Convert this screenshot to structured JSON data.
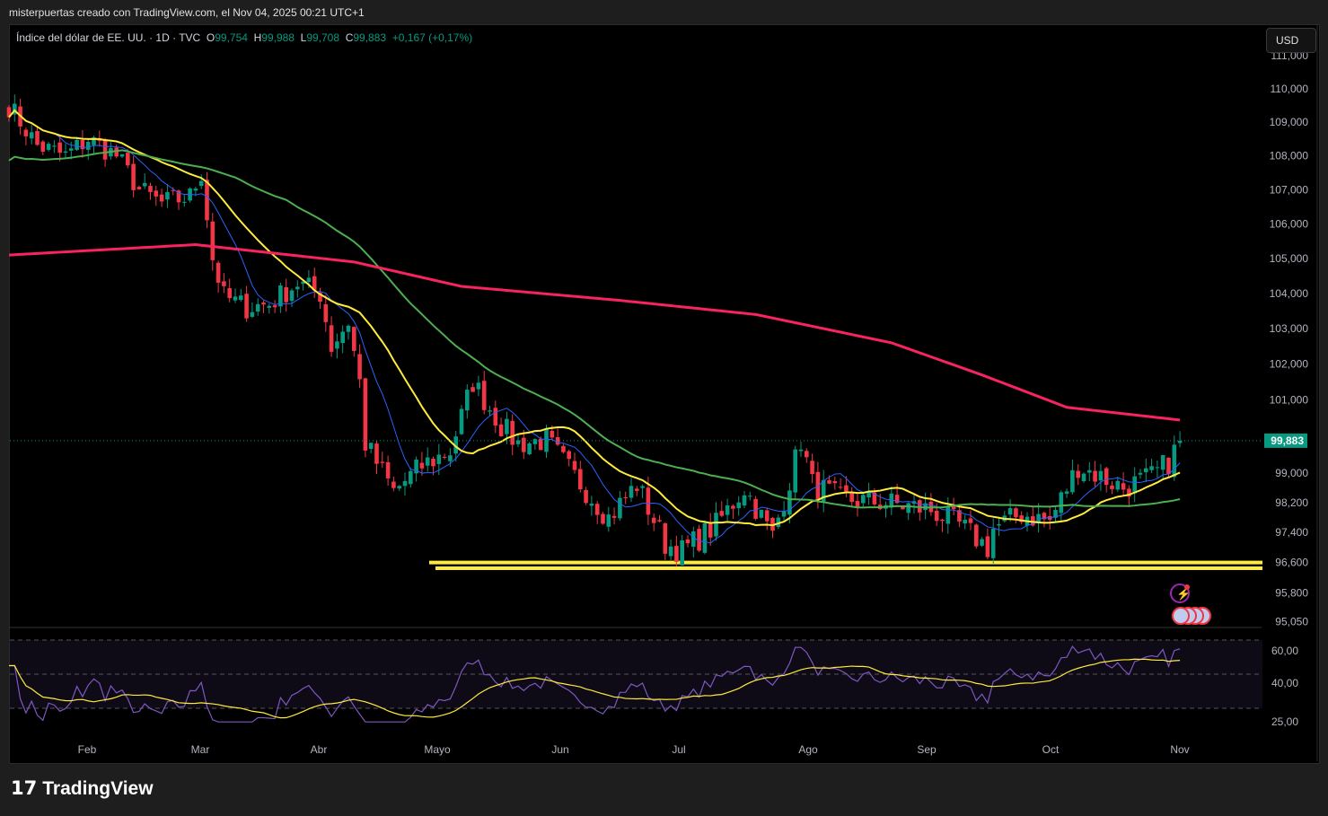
{
  "header": {
    "credit": "misterpuertas creado con TradingView.com, el Nov 04, 2025 00:21 UTC+1"
  },
  "legend": {
    "symbol": "Índice del dólar de EE. UU. · 1D · TVC",
    "o_label": "O",
    "open": "99,754",
    "h_label": "H",
    "high": "99,988",
    "l_label": "L",
    "low": "99,708",
    "c_label": "C",
    "close": "99,883",
    "change": "+0,167 (+0,17%)"
  },
  "currency_button": "USD",
  "price_axis": [
    "111,000",
    "110,000",
    "109,000",
    "108,000",
    "107,000",
    "106,000",
    "105,000",
    "104,000",
    "103,000",
    "102,000",
    "101,000",
    "99,000",
    "98,200",
    "97,400",
    "96,600",
    "95,800",
    "95,050"
  ],
  "last_price": "99,883",
  "rsi_axis": [
    "60,00",
    "40,00",
    "25,00"
  ],
  "time_axis": [
    "Feb",
    "Mar",
    "Abr",
    "Mayo",
    "Jun",
    "Jul",
    "Ago",
    "Sep",
    "Oct",
    "Nov"
  ],
  "colors": {
    "up": "#089981",
    "down": "#f23645",
    "ma_fast": "#2962ff",
    "ma_mid": "#ffeb3b",
    "ma_slow": "#4caf50",
    "ma_long": "#f7245f",
    "rsi": "#7e57c2"
  },
  "chart_data": {
    "type": "candlestick",
    "price_path": [
      [
        0,
        109.5
      ],
      [
        5,
        108.3
      ],
      [
        10,
        108.0
      ],
      [
        14,
        108.5
      ],
      [
        19,
        108.0
      ],
      [
        23,
        107.0
      ],
      [
        27,
        106.6
      ],
      [
        32,
        106.8
      ],
      [
        34,
        107.5
      ],
      [
        36,
        105.0
      ],
      [
        38,
        103.9
      ],
      [
        42,
        103.6
      ],
      [
        46,
        103.7
      ],
      [
        51,
        104.3
      ],
      [
        55,
        104.0
      ],
      [
        57,
        102.5
      ],
      [
        60,
        103.2
      ],
      [
        62,
        101.5
      ],
      [
        63,
        99.8
      ],
      [
        68,
        98.5
      ],
      [
        73,
        99.2
      ],
      [
        78,
        99.6
      ],
      [
        82,
        101.5
      ],
      [
        87,
        100.3
      ],
      [
        90,
        99.8
      ],
      [
        95,
        99.9
      ],
      [
        100,
        98.9
      ],
      [
        106,
        97.8
      ],
      [
        111,
        98.7
      ],
      [
        116,
        97.1
      ],
      [
        119,
        96.9
      ],
      [
        125,
        97.6
      ],
      [
        130,
        98.6
      ],
      [
        135,
        97.3
      ],
      [
        138,
        98.8
      ],
      [
        140,
        99.9
      ],
      [
        142,
        98.7
      ],
      [
        147,
        98.3
      ],
      [
        155,
        98.2
      ],
      [
        163,
        98.0
      ],
      [
        168,
        97.6
      ],
      [
        173,
        97.0
      ],
      [
        174,
        97.5
      ],
      [
        179,
        97.9
      ],
      [
        184,
        97.7
      ],
      [
        189,
        99.2
      ],
      [
        193,
        98.9
      ],
      [
        197,
        98.6
      ],
      [
        202,
        98.9
      ],
      [
        205,
        99.3
      ],
      [
        207,
        99.88
      ]
    ],
    "ma200_path": [
      [
        0,
        105.1
      ],
      [
        33,
        105.4
      ],
      [
        61,
        104.9
      ],
      [
        80,
        104.2
      ],
      [
        108,
        103.8
      ],
      [
        132,
        103.4
      ],
      [
        156,
        102.6
      ],
      [
        172,
        101.7
      ],
      [
        187,
        100.8
      ],
      [
        207,
        100.45
      ]
    ],
    "support_levels": [
      96.6,
      96.45
    ]
  }
}
